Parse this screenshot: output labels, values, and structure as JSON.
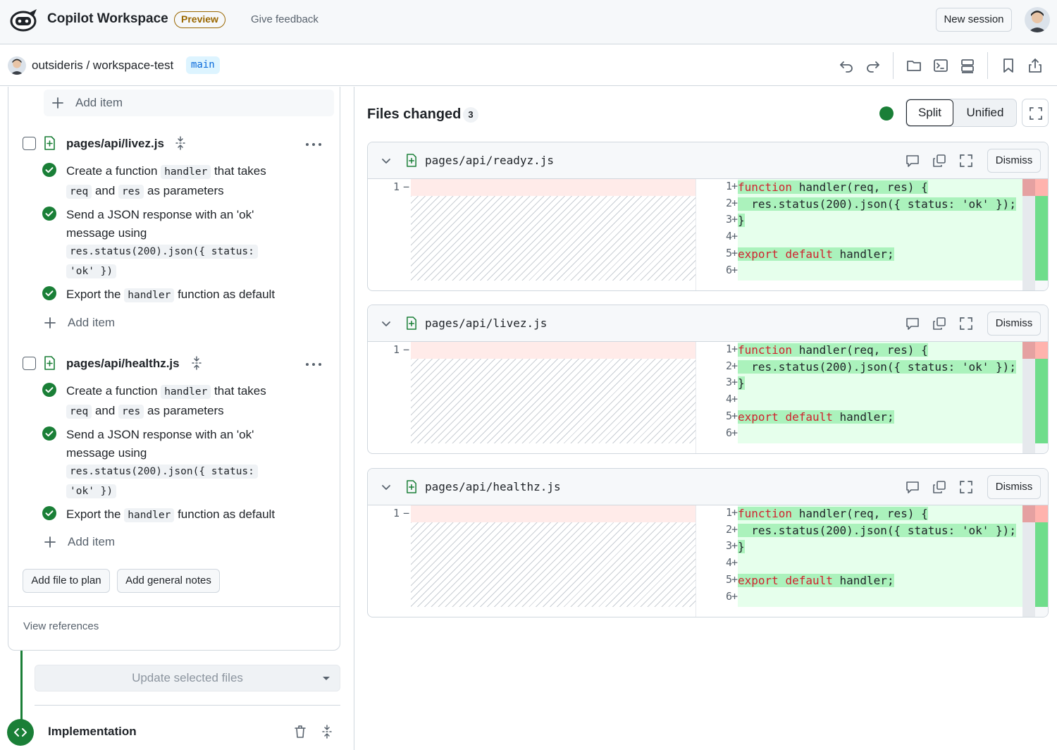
{
  "topbar": {
    "app_title": "Copilot Workspace",
    "badge": "Preview",
    "feedback": "Give feedback",
    "new_session": "New session"
  },
  "repo": {
    "path": "outsideris / workspace-test",
    "branch": "main",
    "tools": [
      "undo-icon",
      "redo-icon",
      "folder-icon",
      "terminal-icon",
      "server-icon",
      "bookmark-icon",
      "share-icon"
    ]
  },
  "plan": {
    "add_item": "Add item",
    "files": [
      {
        "name": "pages/api/livez.js",
        "tasks": {
          "t1": {
            "a": "Create a function",
            "b": "handler",
            "c": "that takes",
            "d": "req",
            "e": "and",
            "f": "res",
            "g": "as parameters"
          },
          "t2": {
            "a": "Send a JSON response with an 'ok' message using",
            "code1": "res.status(200).json({ status:",
            "code2": "'ok' })"
          },
          "t3": {
            "a": "Export the",
            "b": "handler",
            "c": "function as default"
          }
        }
      },
      {
        "name": "pages/api/healthz.js",
        "tasks": {
          "t1": {
            "a": "Create a function",
            "b": "handler",
            "c": "that takes",
            "d": "req",
            "e": "and",
            "f": "res",
            "g": "as parameters"
          },
          "t2": {
            "a": "Send a JSON response with an 'ok' message using",
            "code1": "res.status(200).json({ status:",
            "code2": "'ok' })"
          },
          "t3": {
            "a": "Export the",
            "b": "handler",
            "c": "function as default"
          }
        }
      }
    ],
    "add_file": "Add file to plan",
    "add_notes": "Add general notes",
    "view_references": "View references",
    "update_select": "Update selected files",
    "implementation": "Implementation"
  },
  "files_changed": {
    "title": "Files changed",
    "count": "3",
    "split": "Split",
    "unified": "Unified",
    "dismiss": "Dismiss",
    "old_line": "1",
    "old_sign": "−",
    "diffs": [
      {
        "name": "pages/api/readyz.js"
      },
      {
        "name": "pages/api/livez.js"
      },
      {
        "name": "pages/api/healthz.js"
      }
    ],
    "line_numbers": [
      "1",
      "2",
      "3",
      "4",
      "5",
      "6"
    ],
    "plus": "+",
    "code": {
      "l1_kw": "function",
      "l1_rest": " handler(req, res) {",
      "l2": "  res.status(200).json({ status: 'ok' });",
      "l3": "}",
      "l5_kw1": "export",
      "l5_kw2": "default",
      "l5_rest": " handler;"
    }
  },
  "colors": {
    "accent_green": "#1a7f37",
    "badge": "#9a6700",
    "branch_blue": "#0969da",
    "keyword_red": "#cf222e",
    "added_bg": "#e6ffec",
    "removed_bg": "#ffebe9"
  }
}
